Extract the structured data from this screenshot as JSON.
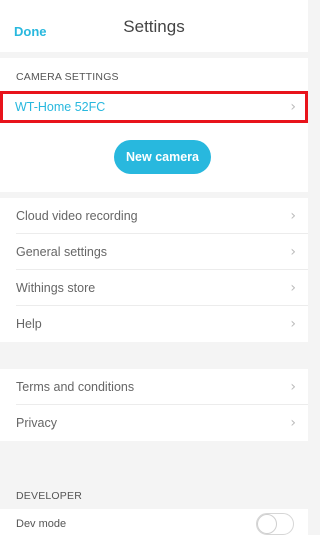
{
  "header": {
    "done_label": "Done",
    "title": "Settings"
  },
  "camera_section": {
    "label": "CAMERA SETTINGS",
    "camera_name": "WT-Home 52FC",
    "new_camera_label": "New camera"
  },
  "menu": {
    "items": [
      {
        "label": "Cloud video recording"
      },
      {
        "label": "General settings"
      },
      {
        "label": "Withings store"
      },
      {
        "label": "Help"
      }
    ]
  },
  "legal": {
    "items": [
      {
        "label": "Terms and conditions"
      },
      {
        "label": "Privacy"
      }
    ]
  },
  "developer": {
    "label": "DEVELOPER",
    "dev_mode_label": "Dev mode",
    "dev_mode_on": false
  },
  "icons": {
    "chevron": "chevron-right-icon"
  },
  "colors": {
    "accent": "#28b8de",
    "highlight_border": "#e8131b",
    "background": "#f4f4f4"
  }
}
